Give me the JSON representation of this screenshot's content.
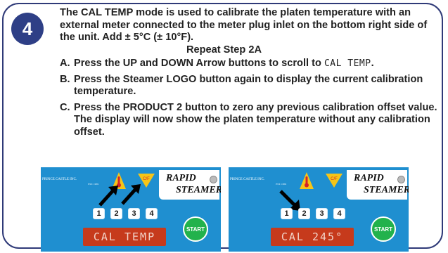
{
  "step_number": "4",
  "intro_text": "The CAL TEMP mode is used to calibrate the platen temperature with an external meter connected to the meter plug inlet on the bottom right side of the unit.  Add ± 5°C (± 10°F).",
  "subheading": "Repeat Step 2A",
  "steps": [
    {
      "letter": "A.",
      "text": "Press the UP and DOWN Arrow buttons to scroll to",
      "display_code": "CAL TEMP",
      "end": "."
    },
    {
      "letter": "B.",
      "text": "Press the Steamer LOGO button again to display the current calibration temperature."
    },
    {
      "letter": "C.",
      "text": "Press the PRODUCT 2 button to zero any previous calibration offset value.  The display will now show the platen temperature without any calibration offset."
    }
  ],
  "panels": [
    {
      "brand_line1": "PRINCE CASTLE INC.",
      "brand_line2": "EST. 1959",
      "cf_label": "C/F",
      "rapid_label_1": "RAPID",
      "rapid_label_2": "STEAMER",
      "buttons": [
        "1",
        "2",
        "3",
        "4"
      ],
      "display": "CAL TEMP",
      "start_label": "START"
    },
    {
      "brand_line1": "PRINCE CASTLE INC.",
      "brand_line2": "EST. 1959",
      "cf_label": "C/F",
      "rapid_label_1": "RAPID",
      "rapid_label_2": "STEAMER",
      "buttons": [
        "1",
        "2",
        "3",
        "4"
      ],
      "display": "CAL 245°",
      "start_label": "START"
    }
  ],
  "colors": {
    "badge": "#2e3f86",
    "border": "#2f3a78",
    "panel_bg": "#1f8fd0",
    "display_bg": "#c63a1c",
    "start_green": "#22b24c",
    "thermometer_red": "#d2232a",
    "cf_yellow": "#f5c518"
  }
}
